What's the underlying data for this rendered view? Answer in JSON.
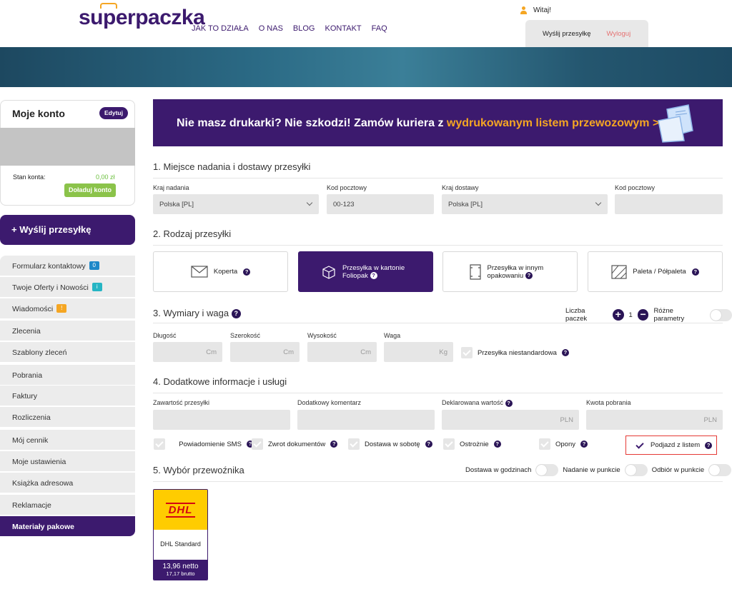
{
  "header": {
    "logo": "superpaczka",
    "nav": [
      "JAK TO DZIAŁA",
      "O NAS",
      "BLOG",
      "KONTAKT",
      "FAQ"
    ],
    "greeting": "Witaj!",
    "send_link": "Wyślij przesyłkę",
    "logout": "Wyloguj"
  },
  "sidebar": {
    "account_title": "Moje konto",
    "edit_label": "Edytuj",
    "balance_label": "Stan konta:",
    "balance_value": "0,00 zł",
    "topup_label": "Doładuj konto",
    "send_button": "Wyślij przesyłkę",
    "menu": [
      {
        "label": "Formularz kontaktowy",
        "badge": "0",
        "badge_color": "#1e88c8"
      },
      {
        "label": "Twoje Oferty i Nowości",
        "badge": "i",
        "badge_color": "#26b5c4"
      },
      {
        "label": "Wiadomości",
        "badge": "!",
        "badge_color": "#f5a623"
      },
      {
        "label": "Zlecenia"
      },
      {
        "label": "Szablony zleceń"
      },
      {
        "label": "Pobrania"
      },
      {
        "label": "Faktury"
      },
      {
        "label": "Rozliczenia"
      },
      {
        "label": "Mój cennik"
      },
      {
        "label": "Moje ustawienia"
      },
      {
        "label": "Książka adresowa"
      },
      {
        "label": "Reklamacje"
      },
      {
        "label": "Materiały pakowe"
      }
    ]
  },
  "promo": {
    "text": "Nie masz drukarki? Nie szkodzi! Zamów kuriera z ",
    "highlight": "wydrukowanym listem przewozowym >"
  },
  "section1": {
    "title": "1. Miejsce nadania i dostawy przesyłki",
    "from_country_label": "Kraj nadania",
    "from_country": "Polska [PL]",
    "from_zip_label": "Kod pocztowy",
    "from_zip": "00-123",
    "to_country_label": "Kraj dostawy",
    "to_country": "Polska [PL]",
    "to_zip_label": "Kod pocztowy",
    "to_zip": ""
  },
  "section2": {
    "title": "2. Rodzaj przesyłki",
    "types": [
      "Koperta",
      "Przesyłka w kartonie Foliopak",
      "Przesyłka w innym opakowaniu",
      "Paleta / Półpaleta"
    ]
  },
  "section3": {
    "title": "3. Wymiary i waga",
    "count_label": "Liczba paczek",
    "count": "1",
    "diff_params": "Różne parametry",
    "length_label": "Długość",
    "width_label": "Szerokość",
    "height_label": "Wysokość",
    "weight_label": "Waga",
    "unit_cm": "Cm",
    "unit_kg": "Kg",
    "nonstandard": "Przesyłka niestandardowa"
  },
  "section4": {
    "title": "4. Dodatkowe informacje i usługi",
    "contents_label": "Zawartość przesyłki",
    "comment_label": "Dodatkowy komentarz",
    "declared_label": "Deklarowana wartość",
    "cod_label": "Kwota pobrania",
    "currency": "PLN",
    "options": [
      "Powiadomienie SMS",
      "Zwrot dokumentów",
      "Dostawa w sobotę",
      "Ostrożnie",
      "Opony",
      "Podjazd z listem"
    ]
  },
  "section5": {
    "title": "5. Wybór przewoźnika",
    "filters": [
      "Dostawa w godzinach",
      "Nadanie w punkcie",
      "Odbiór w punkcie"
    ],
    "carrier_logo": "DHL",
    "carrier_name": "DHL Standard",
    "price_net": "13,96 netto",
    "price_gross": "17,17 brutto"
  },
  "colors": {
    "brand": "#3c1a6e",
    "accent": "#f5a623",
    "green": "#8bc34a",
    "highlight_border": "#e53935"
  }
}
